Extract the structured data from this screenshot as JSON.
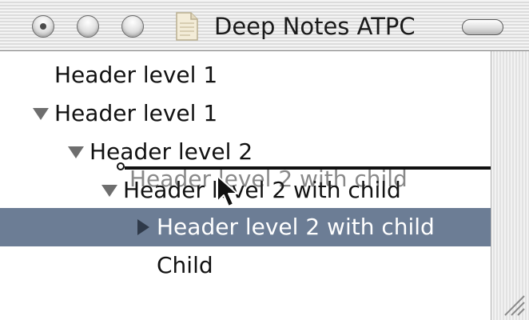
{
  "window": {
    "title": "Deep Notes ATPC"
  },
  "outline": {
    "rows": [
      {
        "label": "Header level 1",
        "disclosure": "none"
      },
      {
        "label": "Header level 1",
        "disclosure": "expanded"
      },
      {
        "label": "Header level 2",
        "disclosure": "expanded"
      },
      {
        "label": "Header level 2 with child",
        "disclosure": "expanded"
      },
      {
        "label": "Header level 2 with child",
        "disclosure": "collapsed",
        "selected": true
      },
      {
        "label": "Child",
        "disclosure": "none"
      }
    ]
  },
  "drag": {
    "ghost_label": "Header level 2 with child"
  },
  "colors": {
    "selection": "#6c7d95",
    "disclosure_triangle": "#6e6e6e"
  },
  "icons": {
    "close": "close-button-icon",
    "minimize": "minimize-button-icon",
    "zoom": "zoom-button-icon",
    "document": "document-icon",
    "toolbar_toggle": "toolbar-toggle-icon",
    "triangle_expanded": "disclosure-down-icon",
    "triangle_collapsed": "disclosure-right-icon",
    "cursor": "arrow-cursor-icon",
    "resize": "resize-grip-icon"
  }
}
